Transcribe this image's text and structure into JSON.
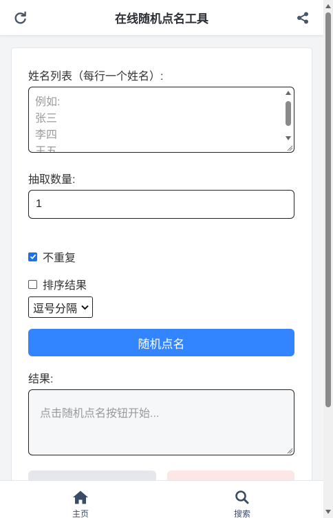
{
  "header": {
    "title": "在线随机点名工具",
    "refresh_icon": "refresh-icon",
    "share_icon": "share-icon"
  },
  "form": {
    "names_label": "姓名列表（每行一个姓名）:",
    "names_placeholder": "例如:\n张三\n李四\n王五",
    "count_label": "抽取数量:",
    "count_value": "1",
    "no_repeat_label": "不重复",
    "no_repeat_checked": true,
    "sort_label": "排序结果",
    "sort_checked": false,
    "separator_selected": "逗号分隔",
    "pick_button": "随机点名",
    "result_label": "结果:",
    "result_placeholder": "点击随机点名按钮开始..."
  },
  "bottom_nav": {
    "items": [
      {
        "label": "主页",
        "icon": "home-icon"
      },
      {
        "label": "搜索",
        "icon": "search-icon"
      }
    ]
  },
  "colors": {
    "accent": "#3385ff",
    "checkbox": "#1a73e8",
    "nav_text": "#3a4b66"
  }
}
